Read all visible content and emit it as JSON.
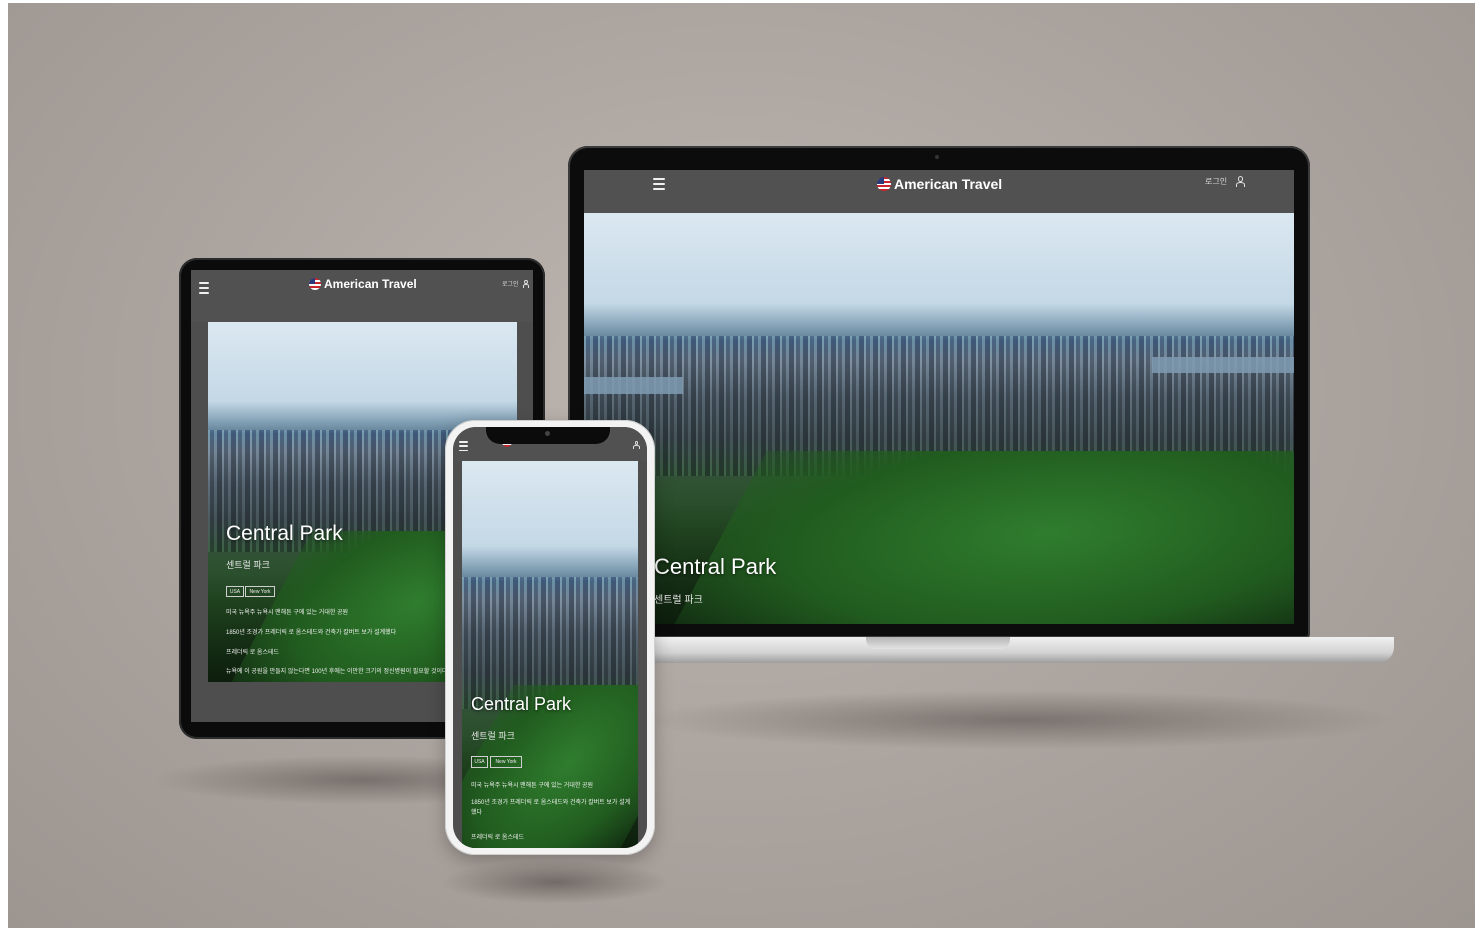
{
  "site": {
    "brand": "American Travel",
    "login_label": "로그인"
  },
  "hero": {
    "title": "Central Park",
    "subtitle": "센트럴 파크",
    "tags": [
      "USA",
      "New York"
    ],
    "lines": [
      "미국 뉴욕주 뉴욕시 맨해튼 구에 있는 거대한 공원",
      "1850년 조경가 프레더릭 로 옴스테드와 건축가 칼버트 보가 설계했다",
      "프레더릭 로 옴스테드",
      "뉴욕에 이 공원을 만들지 않는다면 100년 후에는 이만한 크기의 정신병원이 필요할 것이다"
    ]
  },
  "colors": {
    "topbar": "#515151",
    "background": "#aba39e",
    "flag_red": "#c8262e",
    "flag_blue": "#2b3a78"
  },
  "icons": {
    "menu": "menu-icon",
    "user": "user-icon",
    "flag": "flag-icon"
  }
}
